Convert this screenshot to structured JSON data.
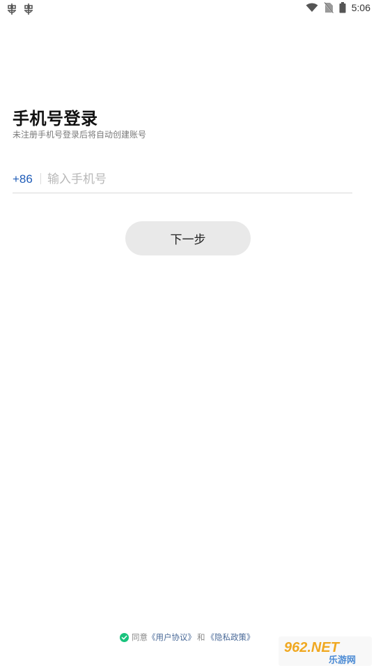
{
  "status_bar": {
    "time": "5:06",
    "notification_icons": [
      "bug-icon",
      "bug-icon"
    ],
    "system_icons": [
      "wifi-icon",
      "no-sim-icon",
      "battery-icon"
    ]
  },
  "login": {
    "title": "手机号登录",
    "subtitle": "未注册手机号登录后将自动创建账号",
    "country_code": "+86",
    "phone_placeholder": "输入手机号",
    "phone_value": "",
    "next_button": "下一步"
  },
  "agreement": {
    "prefix": "同意",
    "user_agreement": "《用户协议》",
    "and": "和",
    "privacy_policy": "《隐私政策》",
    "checked": true
  },
  "watermark": {
    "top": "962.NET",
    "bottom": "乐游网"
  },
  "colors": {
    "accent_blue": "#1f5cb8",
    "button_bg": "#e9e9e9",
    "check_green": "#19c37d",
    "link_blue": "#4a6a98"
  }
}
